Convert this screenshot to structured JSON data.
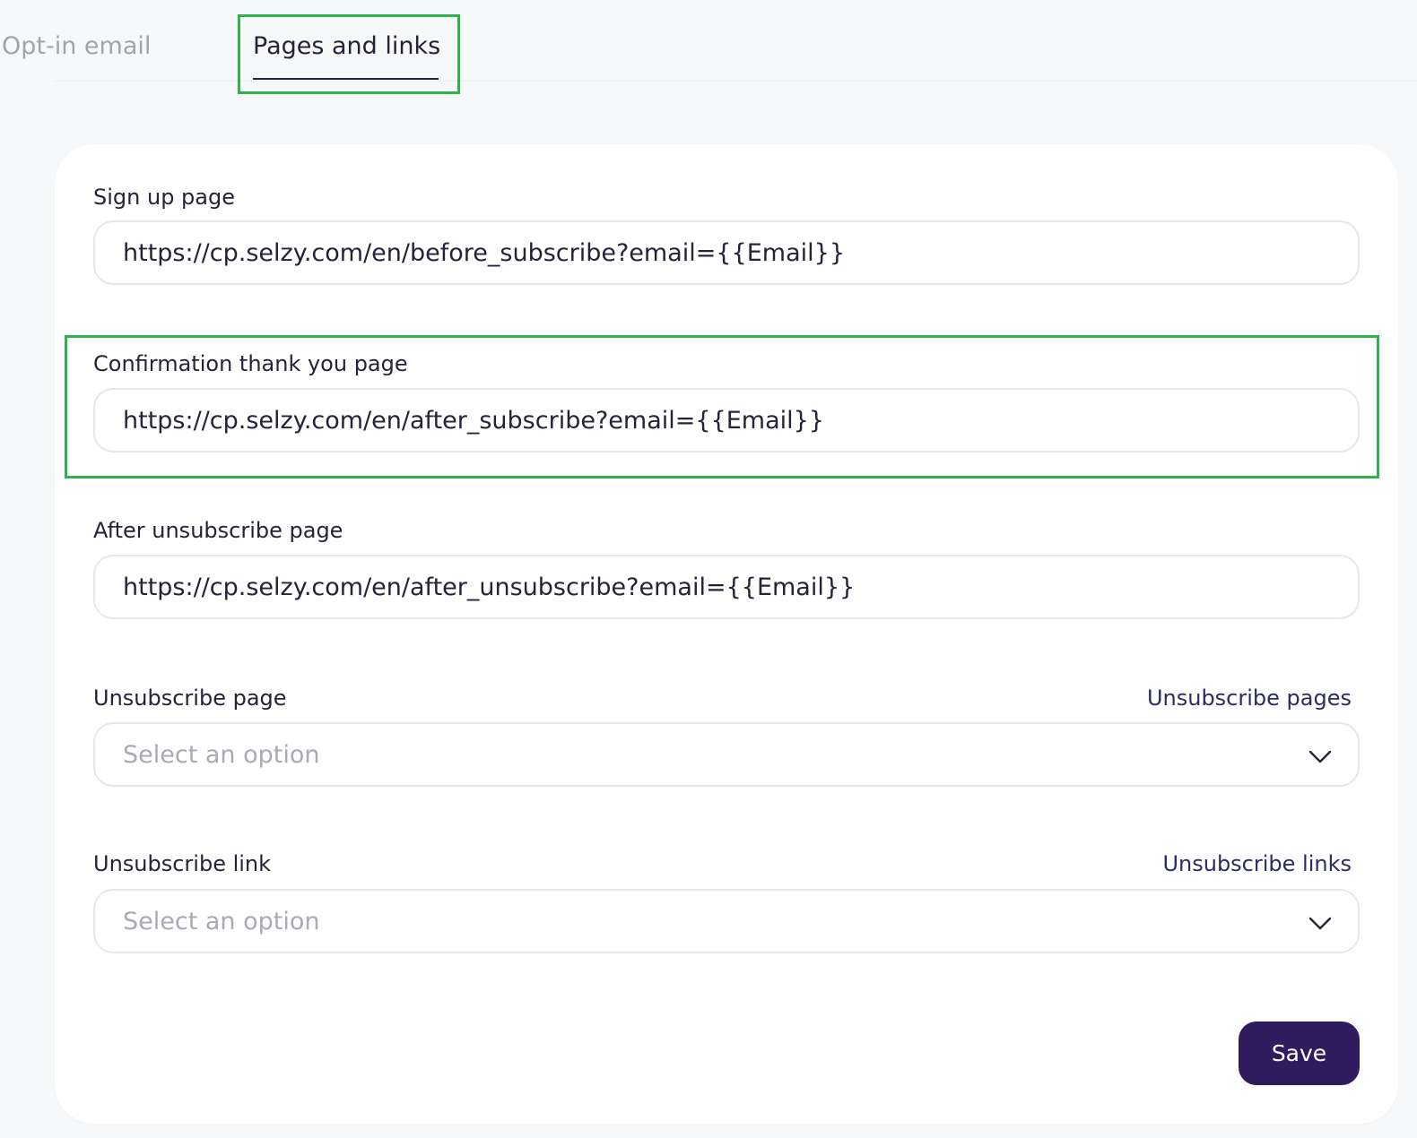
{
  "tabs": [
    {
      "label": "Opt-in email",
      "active": false
    },
    {
      "label": "Pages and links",
      "active": true
    }
  ],
  "fields": {
    "signup": {
      "label": "Sign up page",
      "value": "https://cp.selzy.com/en/before_subscribe?email={{Email}}"
    },
    "confirmation": {
      "label": "Confirmation thank you page",
      "value": "https://cp.selzy.com/en/after_subscribe?email={{Email}}"
    },
    "after_unsubscribe": {
      "label": "After unsubscribe page",
      "value": "https://cp.selzy.com/en/after_unsubscribe?email={{Email}}"
    },
    "unsubscribe_page": {
      "label": "Unsubscribe page",
      "link": "Unsubscribe pages",
      "placeholder": "Select an option"
    },
    "unsubscribe_link": {
      "label": "Unsubscribe link",
      "link": "Unsubscribe links",
      "placeholder": "Select an option"
    }
  },
  "actions": {
    "save_label": "Save"
  },
  "colors": {
    "highlight": "#2fb24a",
    "primary_button": "#2f1b5e",
    "link": "#2e2b63"
  },
  "icons": {
    "dropdown": "chevron-down-icon"
  }
}
